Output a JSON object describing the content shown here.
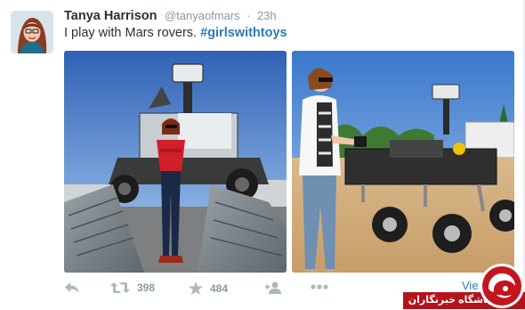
{
  "tweet": {
    "author_name": "Tanya Harrison",
    "author_handle": "@tanyaofmars",
    "separator": "·",
    "timestamp": "23h",
    "text": "I play with Mars rovers.",
    "hashtag": "#girlswithtoys"
  },
  "media": [
    {
      "description": "Woman in red shirt and jeans standing on a ramp in front of a Mars rover test vehicle",
      "icon": "photo"
    },
    {
      "description": "Woman in white cardigan with sunglasses using a remote control beside a rover on sand",
      "icon": "photo"
    }
  ],
  "actions": {
    "reply_icon": "reply-icon",
    "retweet_count": "398",
    "favorite_count": "484",
    "follow_icon": "follow-icon",
    "more_icon": "more-icon"
  },
  "view_link": "Vie",
  "watermark": {
    "text": "باشگاه خبرنگاران",
    "color": "#b5121b"
  },
  "colors": {
    "link": "#2b7bb9",
    "text": "#292f33",
    "muted": "#8899a6",
    "icon": "#aab8c2"
  }
}
